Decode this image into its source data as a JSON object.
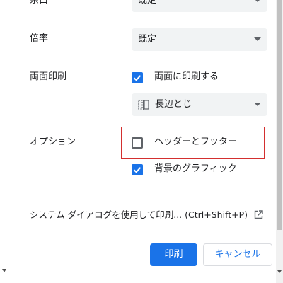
{
  "settings": {
    "margins": {
      "label": "余白",
      "value": "既定"
    },
    "scale": {
      "label": "倍率",
      "value": "既定"
    },
    "duplex": {
      "label": "両面印刷",
      "checkbox_label": "両面に印刷する",
      "checked": true,
      "flip_value": "長辺とじ"
    },
    "options": {
      "label": "オプション",
      "headers_footers": {
        "label": "ヘッダーとフッター",
        "checked": false
      },
      "background_graphics": {
        "label": "背景のグラフィック",
        "checked": true
      }
    }
  },
  "system_dialog": {
    "label": "システム ダイアログを使用して印刷... (Ctrl+Shift+P)"
  },
  "buttons": {
    "print": "印刷",
    "cancel": "キャンセル"
  },
  "colors": {
    "accent": "#1a73e8",
    "highlight_border": "#d32f2f",
    "select_bg": "#f1f3f4"
  },
  "icons": {
    "dropdown": "chevron-down-icon",
    "flip": "flip-long-edge-icon",
    "external": "open-in-new-icon",
    "check": "checkmark-icon"
  }
}
